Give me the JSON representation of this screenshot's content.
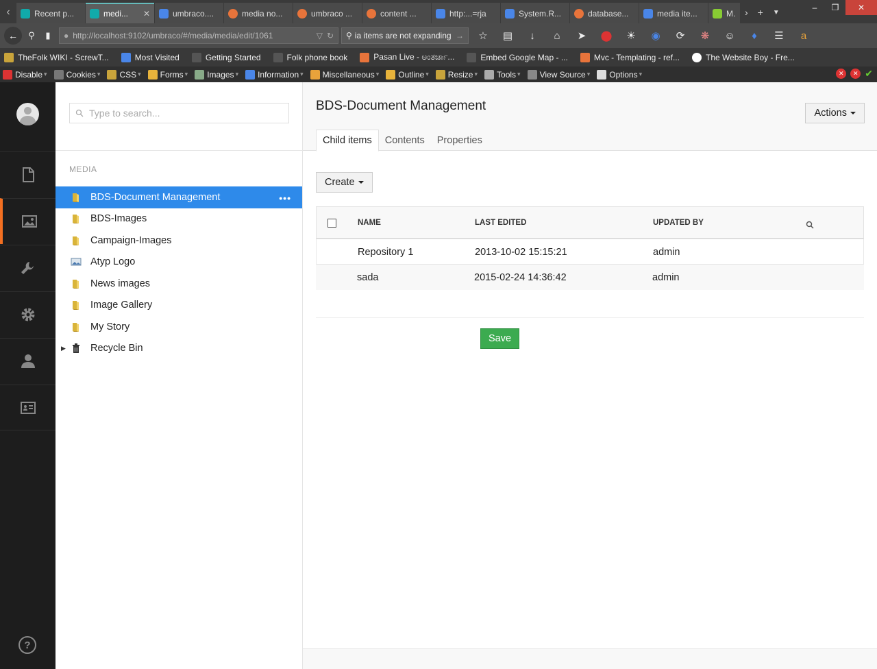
{
  "browser": {
    "tabs": [
      {
        "label": "Recent p...",
        "fav": "fav-m",
        "active": false
      },
      {
        "label": "medi...",
        "fav": "fav-m",
        "active": true
      },
      {
        "label": "umbraco....",
        "fav": "fav-g",
        "active": false
      },
      {
        "label": "media no...",
        "fav": "fav-o",
        "active": false
      },
      {
        "label": "umbraco ...",
        "fav": "fav-o",
        "active": false
      },
      {
        "label": "content ...",
        "fav": "fav-o",
        "active": false
      },
      {
        "label": "http:...=rja",
        "fav": "fav-g",
        "active": false
      },
      {
        "label": "System.R...",
        "fav": "fav-g",
        "active": false
      },
      {
        "label": "database...",
        "fav": "fav-o",
        "active": false
      },
      {
        "label": "media ite...",
        "fav": "fav-g",
        "active": false
      },
      {
        "label": "Mo",
        "fav": "fav-y",
        "active": false
      }
    ],
    "url": "http://localhost:9102/umbraco/#/media/media/edit/1061",
    "search_value": "ia items are not expanding",
    "bookmarks": [
      {
        "label": "TheFolk WIKI - ScrewT...",
        "ic": "ic-crown"
      },
      {
        "label": "Most Visited",
        "ic": "ic-blue"
      },
      {
        "label": "Getting Started",
        "ic": "ic-gray"
      },
      {
        "label": "Folk phone book",
        "ic": "ic-gray"
      },
      {
        "label": "Pasan Live - ಅಂತರ್ಜಾ...",
        "ic": "ic-orange"
      },
      {
        "label": "Embed Google Map - ...",
        "ic": "ic-gray"
      },
      {
        "label": "Mvc - Templating - ref...",
        "ic": "ic-orange"
      },
      {
        "label": "The Website Boy - Fre...",
        "ic": "ic-white"
      }
    ],
    "devtools": [
      {
        "label": "Disable",
        "ic": "#d33"
      },
      {
        "label": "Cookies",
        "ic": "#777"
      },
      {
        "label": "CSS",
        "ic": "#c9a43b"
      },
      {
        "label": "Forms",
        "ic": "#e8b33b"
      },
      {
        "label": "Images",
        "ic": "#8a8"
      },
      {
        "label": "Information",
        "ic": "#4a86e8"
      },
      {
        "label": "Miscellaneous",
        "ic": "#e8a33b"
      },
      {
        "label": "Outline",
        "ic": "#e8b33b"
      },
      {
        "label": "Resize",
        "ic": "#c9a43b"
      },
      {
        "label": "Tools",
        "ic": "#aaa"
      },
      {
        "label": "View Source",
        "ic": "#888"
      },
      {
        "label": "Options",
        "ic": "#ddd"
      }
    ]
  },
  "tree": {
    "search_placeholder": "Type to search...",
    "root_label": "MEDIA",
    "items": [
      {
        "label": "BDS-Document Management",
        "icon": "folder",
        "selected": true
      },
      {
        "label": "BDS-Images",
        "icon": "folder",
        "selected": false
      },
      {
        "label": "Campaign-Images",
        "icon": "folder",
        "selected": false
      },
      {
        "label": "Atyp Logo",
        "icon": "image",
        "selected": false
      },
      {
        "label": "News images",
        "icon": "folder",
        "selected": false
      },
      {
        "label": "Image Gallery",
        "icon": "folder",
        "selected": false
      },
      {
        "label": "My Story",
        "icon": "folder",
        "selected": false
      },
      {
        "label": "Recycle Bin",
        "icon": "trash",
        "selected": false
      }
    ],
    "more_label": "•••"
  },
  "main": {
    "title": "BDS-Document Management",
    "actions_label": "Actions",
    "tabs": [
      "Child items",
      "Contents",
      "Properties"
    ],
    "create_label": "Create",
    "columns": [
      "NAME",
      "LAST EDITED",
      "UPDATED BY"
    ],
    "rows": [
      {
        "name": "Repository 1",
        "edited": "2013-10-02 15:15:21",
        "by": "admin"
      },
      {
        "name": "sada",
        "edited": "2015-02-24 14:36:42",
        "by": "admin"
      }
    ],
    "save_label": "Save"
  },
  "colors": {
    "selected": "#2e8aea",
    "accent": "#f36f21",
    "save": "#3cab50"
  }
}
